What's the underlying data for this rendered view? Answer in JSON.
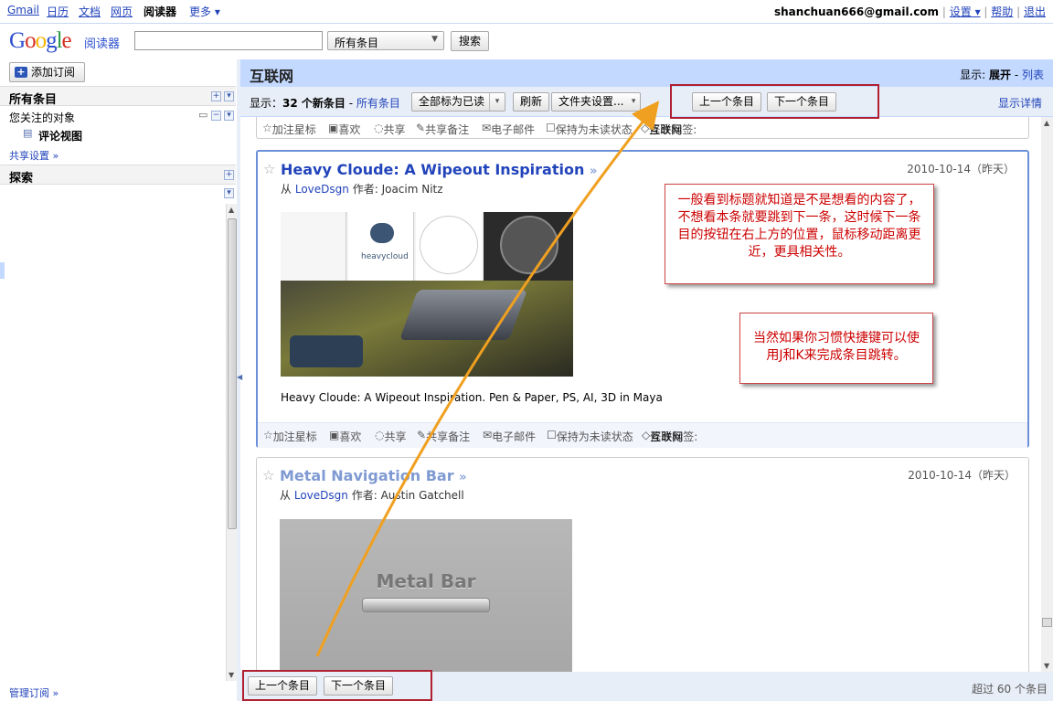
{
  "gbar": {
    "links": [
      "Gmail",
      "日历",
      "文档",
      "网页",
      "阅读器",
      "更多 ▾"
    ],
    "user_email": "shanchuan666@gmail.com",
    "settings": "设置 ▾",
    "help": "帮助",
    "logout": "退出"
  },
  "header": {
    "logo": "Google",
    "logo_sub": "阅读器",
    "search_placeholder": "",
    "scope": "所有条目",
    "search_button": "搜索"
  },
  "sidebar": {
    "add_subscription": "添加订阅",
    "all_items": "所有条目",
    "following": "您关注的对象",
    "comment_view": "评论视图",
    "sharing_settings": "共享设置 »",
    "explore": "探索",
    "manage_subscriptions": "管理订阅 »"
  },
  "main": {
    "title": "互联网",
    "view_label": "显示:",
    "view_expanded": "展开",
    "view_sep": " - ",
    "view_list": "列表",
    "toolbar": {
      "show_prefix": "显示：",
      "new_count": "32 个新条目",
      "sep": " - ",
      "all_items": "所有条目",
      "mark_all_read": "全部标为已读",
      "refresh": "刷新",
      "folder_settings": "文件夹设置...",
      "prev_item": "上一个条目",
      "next_item": "下一个条目",
      "show_details": "显示详情"
    },
    "actions": {
      "star": "加注星标",
      "like": "喜欢",
      "share": "共享",
      "share_note": "共享备注",
      "email": "电子邮件",
      "keep_unread": "保持为未读状态",
      "edit_tags": "修改标签:",
      "tag": "互联网"
    },
    "entries": [
      {
        "title": "Heavy Cloude: A Wipeout Inspiration",
        "date": "2010-10-14（昨天）",
        "from": "从",
        "source": "LoveDsgn",
        "author_label": "作者:",
        "author": "Joacim Nitz",
        "image_text": "heavycloud",
        "body": "Heavy Cloude: A Wipeout Inspiration. Pen & Paper, PS, AI, 3D in Maya"
      },
      {
        "title": "Metal Navigation Bar",
        "date": "2010-10-14（昨天）",
        "from": "从",
        "source": "LoveDsgn",
        "author_label": "作者:",
        "author": "Austin Gatchell",
        "image_text": "Metal Bar"
      }
    ],
    "bottom": {
      "prev_item": "上一个条目",
      "next_item": "下一个条目",
      "count": "超过 60 个条目"
    }
  },
  "annotations": {
    "note1": "一般看到标题就知道是不是想看的内容了，不想看本条就要跳到下一条，这时候下一条目的按钮在右上方的位置，鼠标移动距离更近，更具相关性。",
    "note2": "当然如果你习惯快捷键可以使用J和K来完成条目跳转。"
  },
  "colors": {
    "header_blue": "#c3d9ff",
    "toolbar_blue": "#e8eef7",
    "link": "#2244bb",
    "annotation_red": "#b02030",
    "arrow_orange": "#f0a020"
  }
}
